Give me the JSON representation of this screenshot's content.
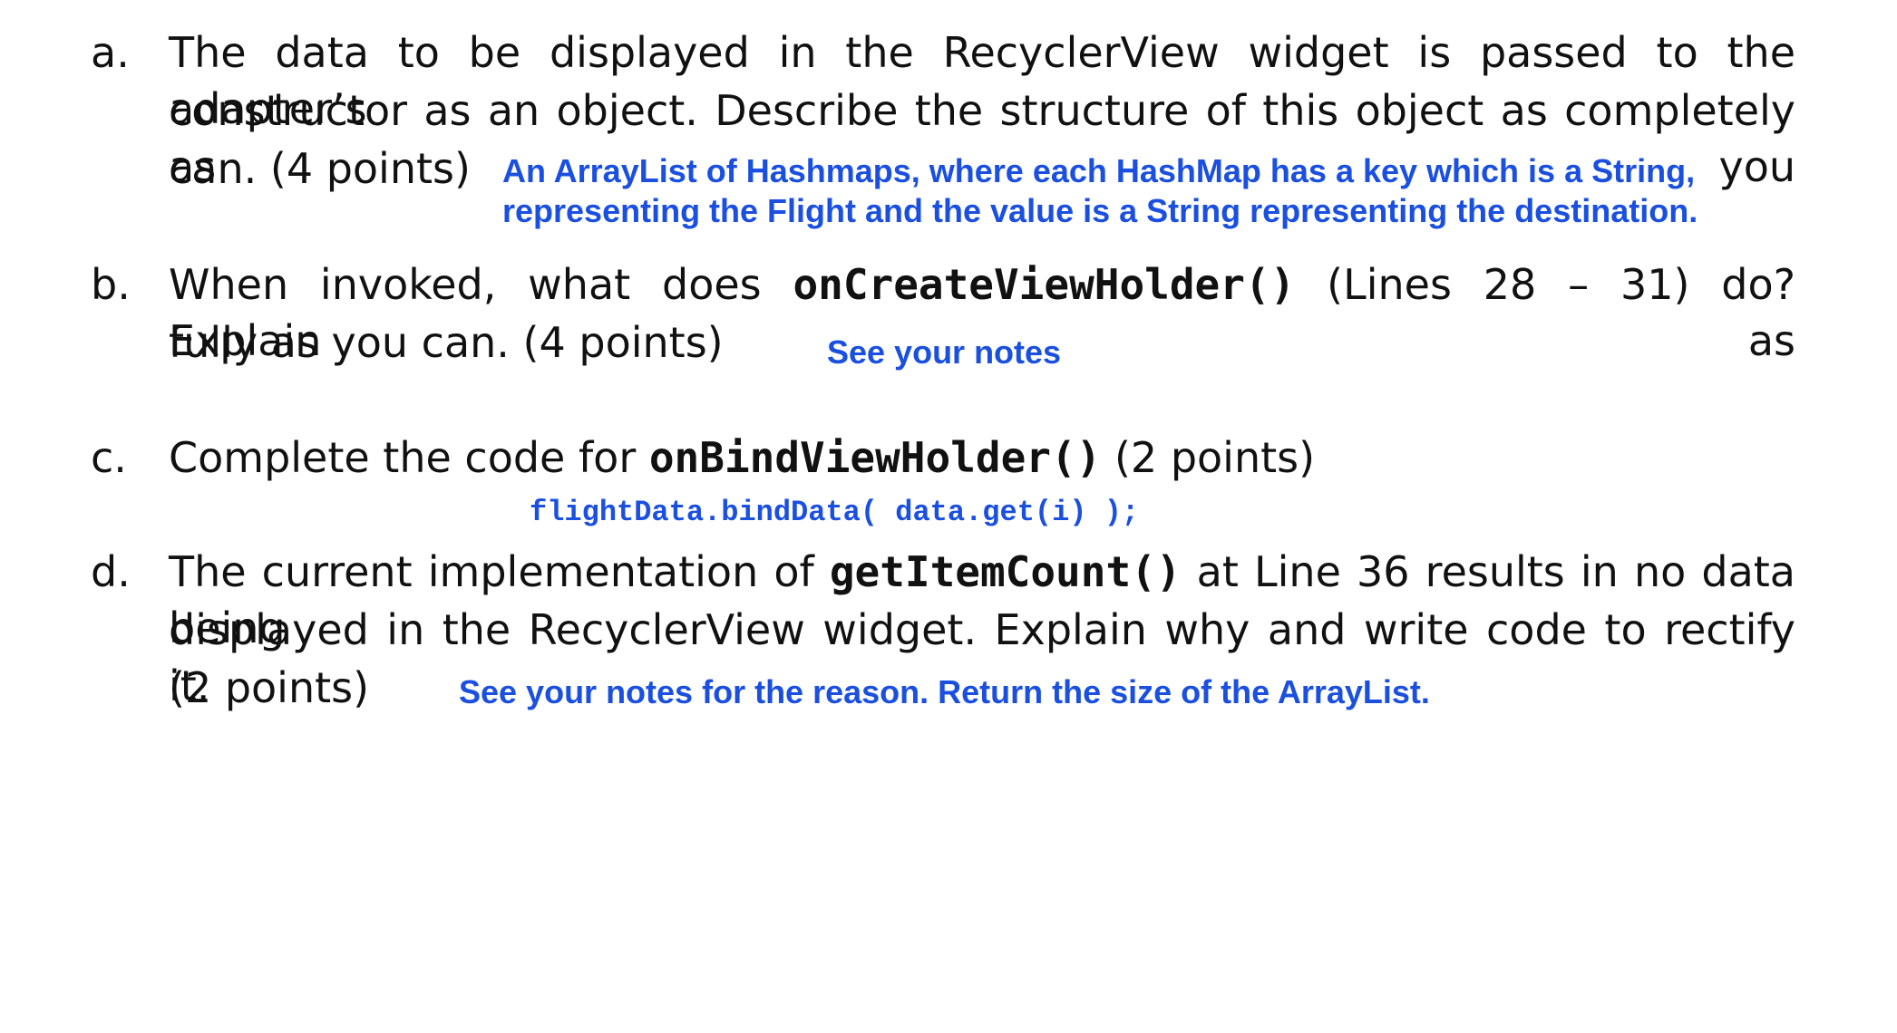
{
  "questions": [
    {
      "letter": "a.",
      "lines": [
        "The data to be displayed in the RecyclerView widget is passed to the adapter’s",
        "constructor as an object. Describe the structure of this object as completely as you",
        "can. (4 points)"
      ],
      "answer": [
        "An ArrayList of Hashmaps, where each HashMap has a key which is a String,",
        "representing the Flight and the value is a String representing the destination."
      ]
    },
    {
      "letter": "b.",
      "line1_prefix": "When invoked, what does ",
      "line1_code": "onCreateViewHolder()",
      "line1_suffix": " (Lines 28 – 31) do? Explain as",
      "line2": "fully as you can.  (4 points)",
      "answer": "See your notes"
    },
    {
      "letter": "c.",
      "line1_prefix": "Complete the code for ",
      "line1_code": "onBindViewHolder()",
      "line1_suffix": "  (2 points)",
      "answer_code": "flightData.bindData( data.get(i) );"
    },
    {
      "letter": "d.",
      "line1_prefix": "The current implementation of ",
      "line1_code": "getItemCount()",
      "line1_suffix": " at Line 36 results in no data being",
      "line2": "displayed in the RecyclerView widget. Explain why and write code to rectify it.",
      "line3": "(2 points)",
      "answer": "See your notes for the reason. Return the size of the ArrayList."
    }
  ]
}
